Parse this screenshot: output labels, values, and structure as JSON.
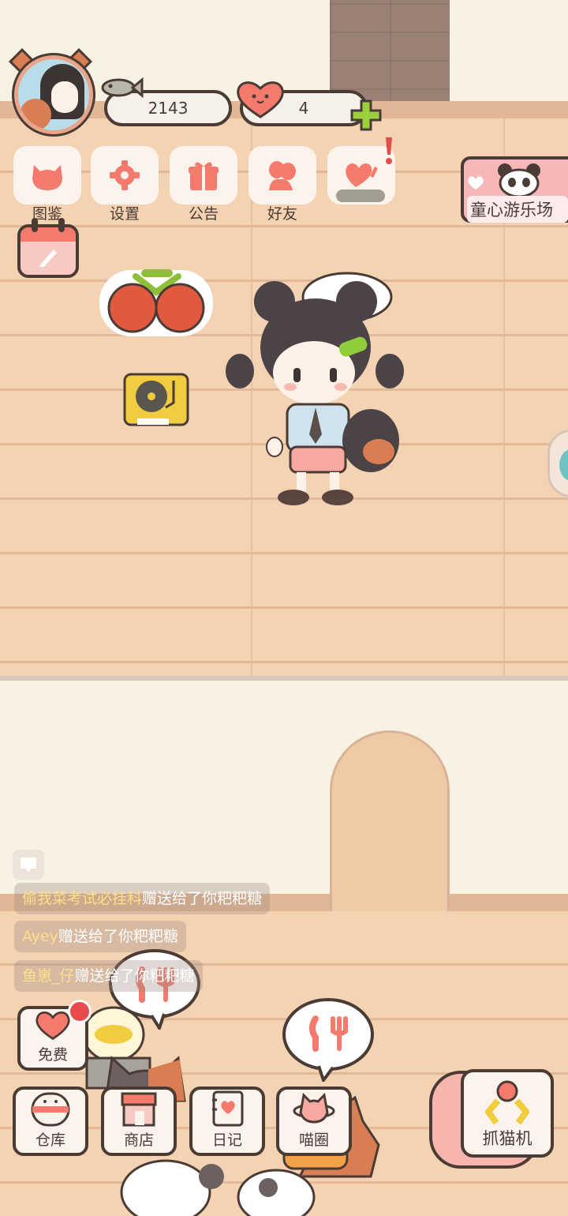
{
  "hud": {
    "fish_count": "2143",
    "heart_count": "4"
  },
  "top_menu": [
    {
      "label": "图鉴",
      "icon": "cat-head-icon"
    },
    {
      "label": "设置",
      "icon": "gear-icon"
    },
    {
      "label": "公告",
      "icon": "gift-icon"
    },
    {
      "label": "好友",
      "icon": "friends-icon"
    },
    {
      "label": "",
      "icon": "heart-notify-icon"
    }
  ],
  "event_banner": {
    "label": "童心游乐场",
    "icon": "panda-icon"
  },
  "chat": {
    "messages": [
      {
        "sender": "偷我菜考试必挂科",
        "text": "赠送给了你粑粑糖"
      },
      {
        "sender": "Ayey",
        "text": "赠送给了你粑粑糖"
      },
      {
        "sender": "鱼崽_仔",
        "text": "赠送给了你粑粑糖"
      }
    ]
  },
  "bottom_menu": {
    "free_label": "免费",
    "items": [
      {
        "label": "仓库",
        "icon": "warehouse-icon"
      },
      {
        "label": "商店",
        "icon": "shop-icon"
      },
      {
        "label": "日记",
        "icon": "diary-icon"
      },
      {
        "label": "喵圈",
        "icon": "cat-planet-icon"
      }
    ],
    "claw_label": "抓猫机"
  },
  "colors": {
    "outline": "#4a3b35",
    "accent_pink": "#f37a6c",
    "floor": "#f4d3b2",
    "wall": "#f7f2e3",
    "plus_green": "#9bcf3b",
    "notify_red": "#e84b4b"
  }
}
